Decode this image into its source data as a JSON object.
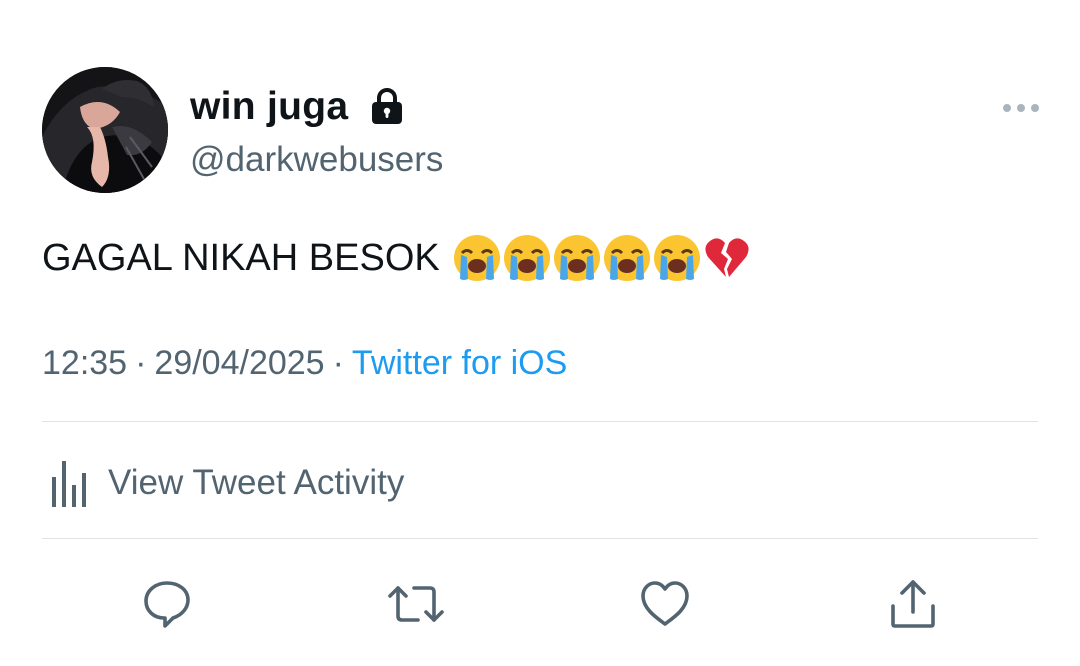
{
  "tweet": {
    "author": {
      "display_name": "win juga",
      "handle": "@darkwebusers",
      "protected_icon": "lock-icon",
      "avatar": "avatar-image"
    },
    "text": "GAGAL NIKAH BESOK",
    "emojis": [
      "loudly-crying-face",
      "loudly-crying-face",
      "loudly-crying-face",
      "loudly-crying-face",
      "loudly-crying-face",
      "broken-heart"
    ],
    "time": "12:35",
    "date": "29/04/2025",
    "separator": "·",
    "source": "Twitter for iOS",
    "activity_label": "View Tweet Activity"
  },
  "icons": {
    "more": "more-horizontal-icon",
    "activity": "bar-chart-icon",
    "reply": "reply-icon",
    "retweet": "retweet-icon",
    "like": "heart-icon",
    "share": "share-icon"
  },
  "colors": {
    "text_primary": "#0f1419",
    "text_secondary": "#536471",
    "link": "#1d9bf0",
    "divider": "#dfe3e6"
  }
}
